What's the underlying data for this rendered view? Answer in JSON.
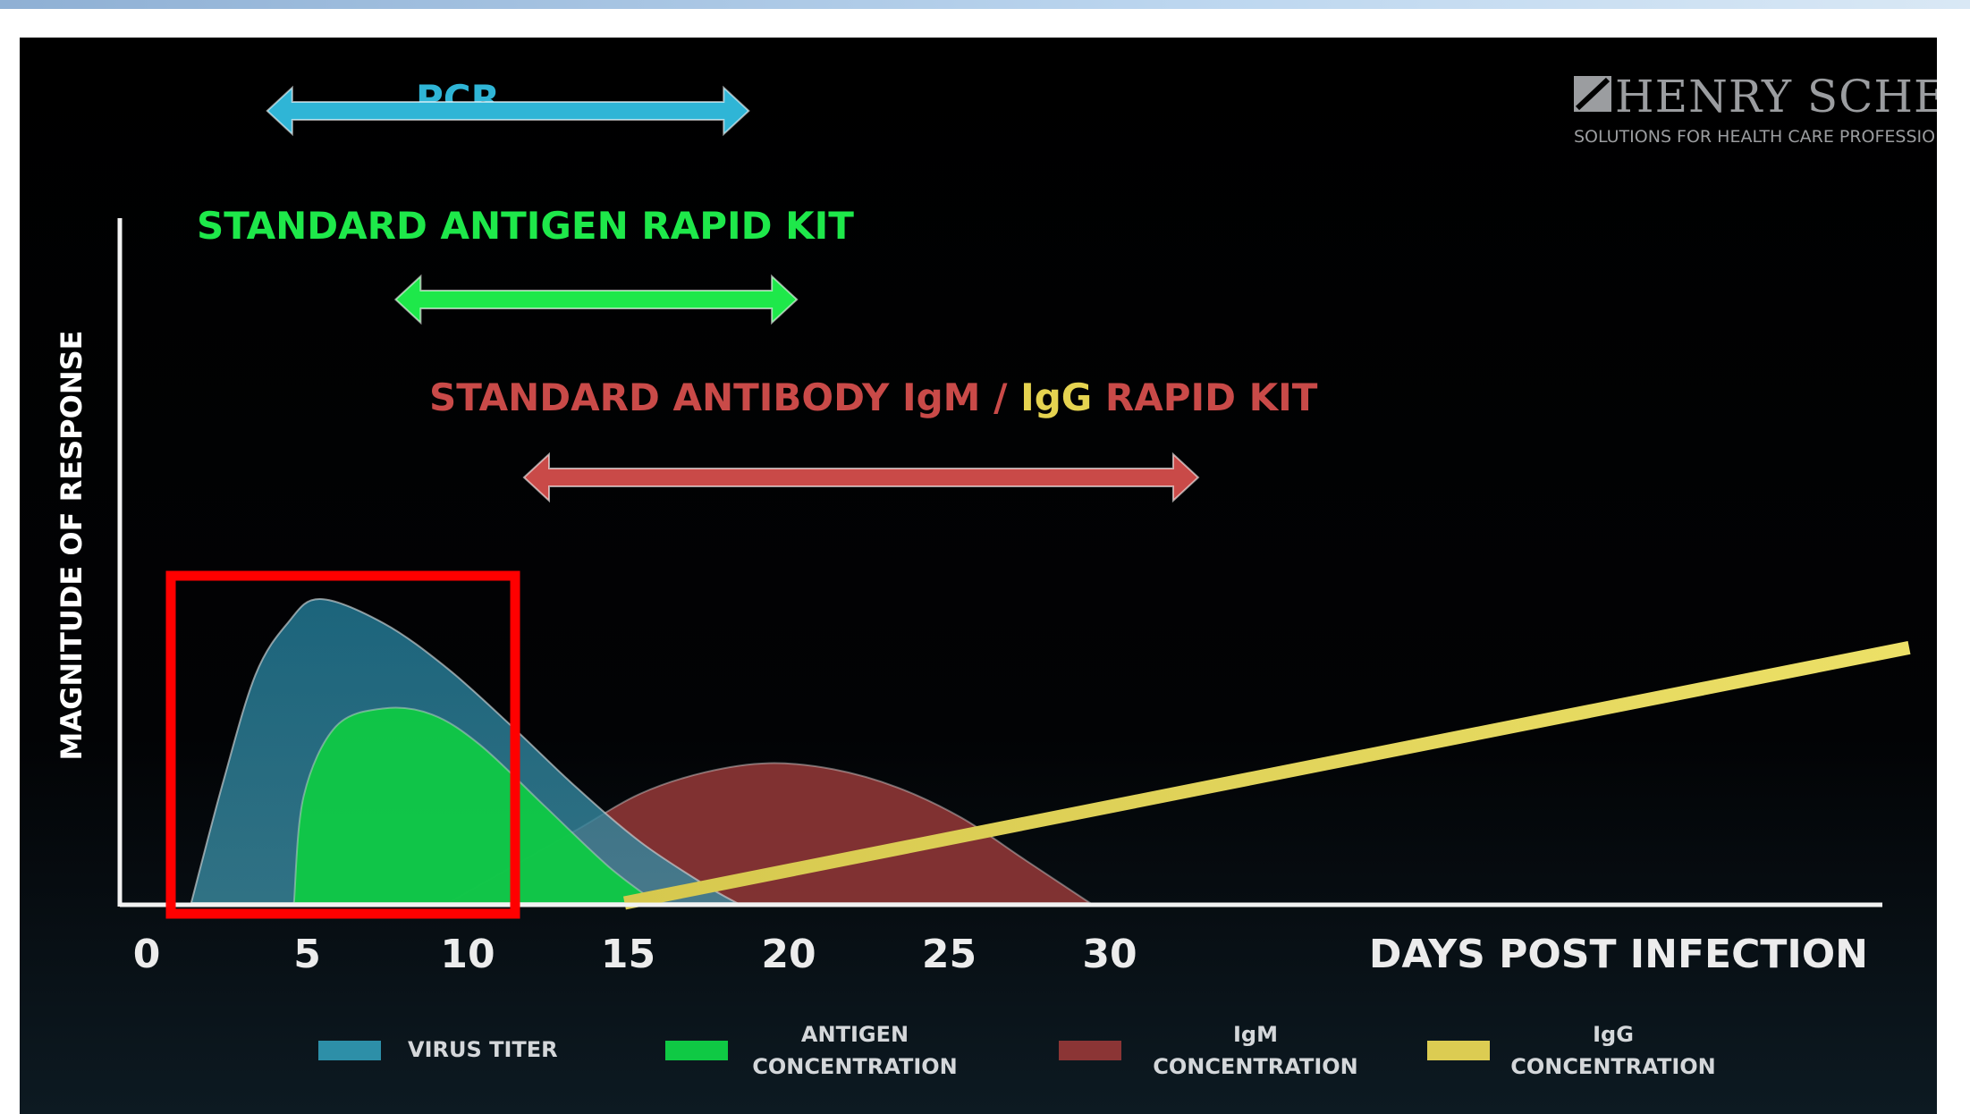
{
  "logo": {
    "wordmark": "HENRY SCHEIN",
    "tagline": "SOLUTIONS FOR HEALTH CARE PROFESSIONALS"
  },
  "tests": {
    "pcr": {
      "label": "PCR",
      "color": "#2fb5d6",
      "start_day": 2,
      "end_day": 17
    },
    "antigen": {
      "label": "STANDARD ANTIGEN RAPID KIT",
      "color": "#1ee84a",
      "start_day": 6,
      "end_day": 18.5
    },
    "antibody": {
      "label_part1": "STANDARD ANTIBODY IgM / ",
      "label_part2": "IgG",
      "label_part3": " RAPID KIT",
      "color": "#c94a48",
      "igg_color": "#e5d350",
      "start_day": 10,
      "end_day": 31
    }
  },
  "highlight": {
    "from_day": 1,
    "to_day": 11,
    "color": "#ff0000"
  },
  "chart_data": {
    "type": "area",
    "ylabel": "MAGNITUDE OF RESPONSE",
    "xlabel": "DAYS POST INFECTION",
    "xticks": [
      0,
      5,
      10,
      15,
      20,
      25,
      30
    ],
    "xlim": [
      0,
      48
    ],
    "ylim": [
      0,
      100
    ],
    "legend_position": "bottom",
    "series": [
      {
        "name": "VIRUS TITER",
        "legend": [
          "VIRUS TITER"
        ],
        "color": "#2d8fa8",
        "x": [
          2,
          3,
          4,
          5,
          6,
          8,
          10,
          12,
          14,
          16,
          18,
          19
        ],
        "y": [
          0,
          40,
          75,
          92,
          100,
          92,
          77,
          58,
          38,
          20,
          6,
          0
        ]
      },
      {
        "name": "ANTIGEN CONCENTRATION",
        "legend": [
          "ANTIGEN",
          "CONCENTRATION"
        ],
        "color": "#0fc944",
        "x": [
          5.2,
          5.5,
          6.5,
          8,
          9.5,
          11,
          13,
          15,
          16.5
        ],
        "y": [
          0,
          35,
          58,
          64,
          62,
          52,
          32,
          12,
          0
        ]
      },
      {
        "name": "IgM CONCENTRATION",
        "legend": [
          "IgM",
          "CONCENTRATION"
        ],
        "color": "#8b3535",
        "x": [
          10,
          12,
          14,
          16,
          18,
          20,
          22,
          24,
          26,
          28,
          30
        ],
        "y": [
          0,
          12,
          24,
          36,
          43,
          46,
          44,
          38,
          28,
          14,
          0
        ]
      },
      {
        "name": "IgG CONCENTRATION",
        "legend": [
          "IgG",
          "CONCENTRATION"
        ],
        "color": "#dccc52",
        "x": [
          15.5,
          48
        ],
        "y": [
          0,
          84
        ]
      }
    ]
  }
}
